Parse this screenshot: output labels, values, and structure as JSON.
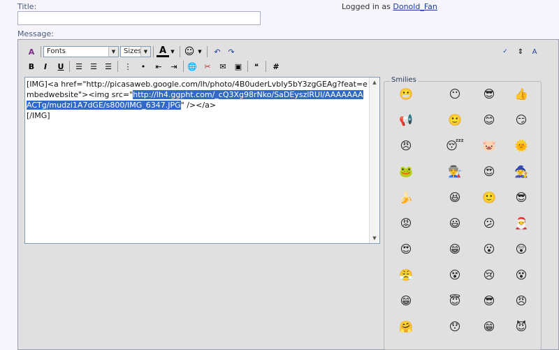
{
  "form": {
    "title_label": "Title:",
    "title_value": "",
    "message_label": "Message:"
  },
  "login": {
    "prefix": "Logged in as",
    "username": "Donold_Fan"
  },
  "toolbar": {
    "font_select": "Fonts",
    "size_select": "Sizes",
    "bold": "B",
    "italic": "I",
    "underline": "U",
    "hash": "#"
  },
  "message": {
    "before": "[IMG]<a href=\"http://picasaweb.google.com/lh/photo/4B0uderLvbIy5bY3zgGEAg?feat=embedwebsite\"><img src=\"",
    "selected": "http://lh4.ggpht.com/_cQ3Xg98rNko/SaDEyszlRUI/AAAAAAAACTg/mudzi1A7dGE/s800/IMG_6347.JPG",
    "after": "\" /></a>\n[/IMG]"
  },
  "smilies": {
    "legend": "Smilies",
    "icons": [
      "😬",
      "😶",
      "😎",
      "👍",
      "📢",
      "🙂",
      "😊",
      "😏",
      "😠",
      "😴",
      "🐷",
      "🌞",
      "🐸",
      "👨‍🏭",
      "😍",
      "🧙",
      "🍌",
      "😆",
      "🙂",
      "😎",
      "😡",
      "😃",
      "😕",
      "🎅",
      "😍",
      "😁",
      "😮",
      "😲",
      "😤",
      "😵",
      "😢",
      "😵",
      "😁",
      "😇",
      "😎",
      "😠",
      "🤗",
      "😯",
      "😁",
      "😈"
    ]
  }
}
